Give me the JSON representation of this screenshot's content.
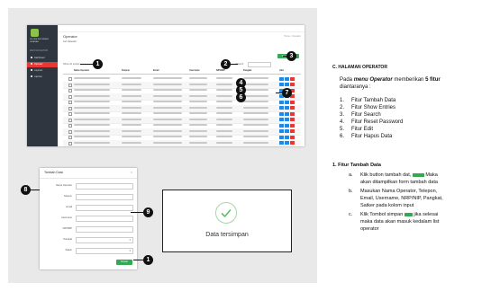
{
  "shot": {
    "app_logo_text": "SISTEM INFORMASI LAYANAN",
    "sidebar_section": "MAIN NAVIGATION",
    "sidebar_items": [
      "Dashboard",
      "Operator",
      "Layanan",
      "Laporan"
    ],
    "page_title": "Operator",
    "breadcrumb": "Home > Operator",
    "sub_title": "List Operator",
    "add_button": "Tambah Data",
    "show_entries": "Show 10 entries",
    "search_label": "Search:",
    "columns": [
      "Nama Operator",
      "Telepon",
      "Email",
      "Username",
      "NIP/NRP",
      "Pangkat",
      "Aksi"
    ]
  },
  "markers": {
    "m1": "1",
    "m2": "2",
    "m3": "3",
    "m4": "4",
    "m5": "5",
    "m6": "6",
    "m7": "7",
    "m8": "8",
    "m9": "9"
  },
  "form": {
    "title": "Tambah Data",
    "close": "×",
    "fields": [
      "Nama Operator",
      "Telepon",
      "Email",
      "Username",
      "NIP/NRP",
      "Pangkat",
      "Satker"
    ],
    "save_label": "Simpan"
  },
  "success": {
    "message": "Data tersimpan"
  },
  "doc": {
    "section_title": "C. HALAMAN OPERATOR",
    "intro_1_pre": "Pada ",
    "intro_1_menu": "menu Operator",
    "intro_1_mid": " memberikan ",
    "intro_1_bold": "5 fitur",
    "intro_2": "diantaranya :",
    "list": [
      {
        "num": "1.",
        "text": "Fitur Tambah Data"
      },
      {
        "num": "2.",
        "text": "Fitur Show Entries"
      },
      {
        "num": "3.",
        "text": "Fitur Search"
      },
      {
        "num": "4.",
        "text": "Fitur Reset Password"
      },
      {
        "num": "5.",
        "text": "Fitur Edit"
      },
      {
        "num": "6.",
        "text": "Fitur Hapus Data"
      }
    ],
    "sub_title": "1. Fitur Tambah Data",
    "step_a_label": "a.",
    "step_a_1": "Klik button tambah dat,",
    "step_a_1_end": "Maka",
    "step_a_2": "akan ditampilkan form tambah data",
    "step_b_label": "b.",
    "step_b_1": "Masukan Nama Operator, Telepon,",
    "step_b_2": "Email, Username, NRP/NIP, Pangkat,",
    "step_b_3": "Satker pada kolom input",
    "step_c_label": "c.",
    "step_c_1": "Klik Tombol simpan",
    "step_c_1_end": "jika selesai",
    "step_c_2": "maka data akan masuk kedalam list",
    "step_c_3": "operator"
  }
}
